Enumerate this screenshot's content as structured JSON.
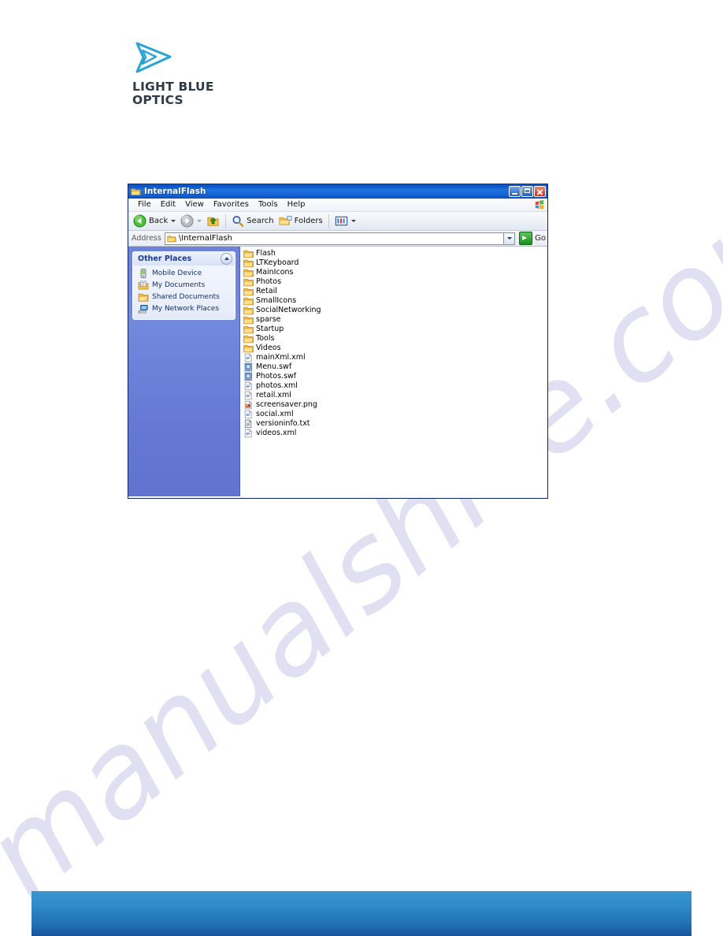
{
  "brand": {
    "logo_icon": "double-chevron-play-icon",
    "line1": "LIGHT BLUE",
    "line2": "OPTICS",
    "accent_color": "#29a3d6"
  },
  "watermark": {
    "text": "manualshive.com",
    "color": "#c8c8e8"
  },
  "window": {
    "title": "InternalFlash",
    "title_icon": "folder-icon",
    "caption_buttons": [
      {
        "name": "minimize",
        "label": "–"
      },
      {
        "name": "maximize",
        "label": "□"
      },
      {
        "name": "close",
        "label": "✕"
      }
    ],
    "menu": {
      "items": [
        "File",
        "Edit",
        "View",
        "Favorites",
        "Tools",
        "Help"
      ],
      "brand_icon": "windows-flag-icon"
    },
    "toolbar": {
      "back_label": "Back",
      "back_icon": "back-arrow-icon",
      "forward_icon": "forward-arrow-icon",
      "up_icon": "up-folder-icon",
      "search_label": "Search",
      "search_icon": "magnifier-icon",
      "folders_label": "Folders",
      "folders_icon": "folders-icon",
      "views_icon": "views-icon"
    },
    "address": {
      "label": "Address",
      "value": "\\InternalFlash",
      "folder_icon": "folder-icon",
      "dropdown_icon": "chevron-down-icon",
      "go_label": "Go",
      "go_icon": "go-arrow-icon"
    },
    "sidebar": {
      "panel_title": "Other Places",
      "collapse_icon": "chevron-up-icon",
      "items": [
        {
          "label": "Mobile Device",
          "icon": "mobile-device-icon"
        },
        {
          "label": "My Documents",
          "icon": "my-documents-icon"
        },
        {
          "label": "Shared Documents",
          "icon": "shared-documents-icon"
        },
        {
          "label": "My Network Places",
          "icon": "network-places-icon"
        }
      ]
    },
    "files": [
      {
        "name": "Flash",
        "type": "folder"
      },
      {
        "name": "LTKeyboard",
        "type": "folder"
      },
      {
        "name": "MainIcons",
        "type": "folder"
      },
      {
        "name": "Photos",
        "type": "folder"
      },
      {
        "name": "Retail",
        "type": "folder"
      },
      {
        "name": "SmallIcons",
        "type": "folder"
      },
      {
        "name": "SocialNetworking",
        "type": "folder"
      },
      {
        "name": "sparse",
        "type": "folder"
      },
      {
        "name": "Startup",
        "type": "folder"
      },
      {
        "name": "Tools",
        "type": "folder"
      },
      {
        "name": "Videos",
        "type": "folder"
      },
      {
        "name": "mainXml.xml",
        "type": "xml"
      },
      {
        "name": "Menu.swf",
        "type": "swf"
      },
      {
        "name": "Photos.swf",
        "type": "swf"
      },
      {
        "name": "photos.xml",
        "type": "xml"
      },
      {
        "name": "retail.xml",
        "type": "xml"
      },
      {
        "name": "screensaver.png",
        "type": "png"
      },
      {
        "name": "social.xml",
        "type": "xml"
      },
      {
        "name": "versioninfo.txt",
        "type": "txt"
      },
      {
        "name": "videos.xml",
        "type": "xml"
      }
    ]
  }
}
